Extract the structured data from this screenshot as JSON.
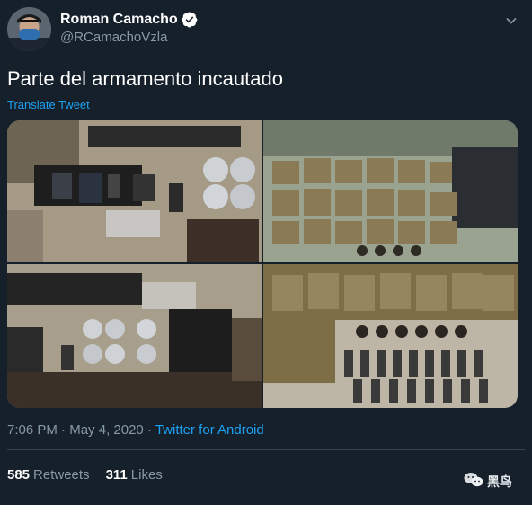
{
  "author": {
    "name": "Roman Camacho",
    "handle": "@RCamachoVzla"
  },
  "tweet": {
    "text": "Parte del armamento incautado",
    "translate_label": "Translate Tweet"
  },
  "meta": {
    "time": "7:06 PM",
    "separator1": " · ",
    "date": "May 4, 2020",
    "separator2": " · ",
    "source": "Twitter for Android"
  },
  "stats": {
    "retweets_count": "585",
    "retweets_label": "Retweets",
    "likes_count": "311",
    "likes_label": "Likes"
  },
  "watermark": {
    "text": "黑鸟"
  },
  "colors": {
    "background": "#15202b",
    "accent": "#1da1f2",
    "secondary_text": "#8899a6",
    "divider": "#38444d"
  },
  "icons": {
    "verified": "verified-badge-icon",
    "menu": "chevron-down-icon",
    "watermark": "wechat-icon"
  }
}
